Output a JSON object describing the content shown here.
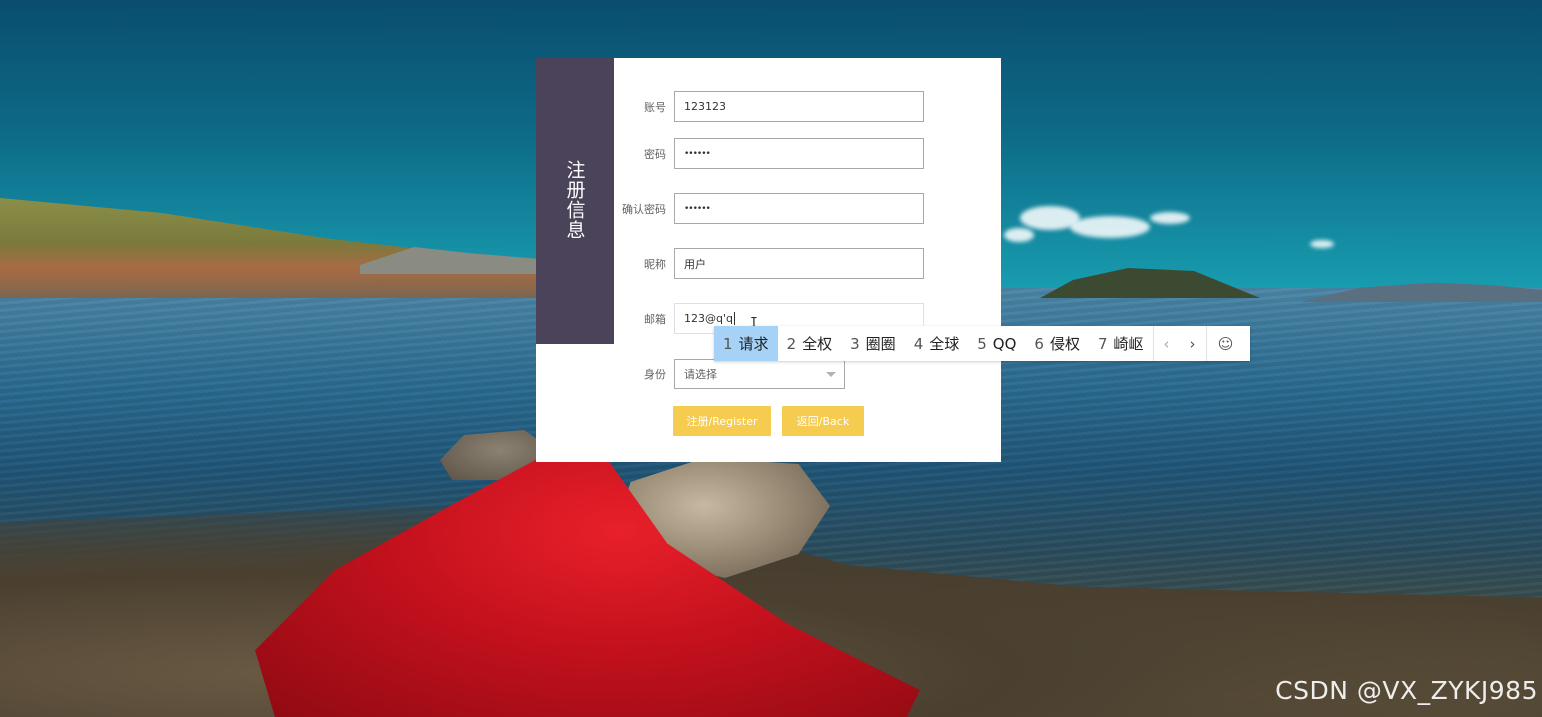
{
  "form": {
    "side_title": "注册信息",
    "fields": {
      "account": {
        "label": "账号",
        "value": "123123"
      },
      "password": {
        "label": "密码",
        "value": "••••••"
      },
      "confirm_password": {
        "label": "确认密码",
        "value": "••••••"
      },
      "nickname": {
        "label": "昵称",
        "value": "用户"
      },
      "email": {
        "label": "邮箱",
        "value": "123@q'q"
      },
      "role": {
        "label": "身份",
        "placeholder": "请选择"
      }
    },
    "buttons": {
      "register": "注册/Register",
      "back": "返回/Back"
    }
  },
  "ime": {
    "candidates": [
      {
        "num": "1",
        "text": "请求"
      },
      {
        "num": "2",
        "text": "全权"
      },
      {
        "num": "3",
        "text": "圈圈"
      },
      {
        "num": "4",
        "text": "全球"
      },
      {
        "num": "5",
        "text": "QQ"
      },
      {
        "num": "6",
        "text": "侵权"
      },
      {
        "num": "7",
        "text": "崎岖"
      }
    ],
    "prev": "‹",
    "next": "›",
    "emoji": "☺"
  },
  "watermark": "CSDN @VX_ZYKJ985",
  "colors": {
    "side_panel": "#4a4359",
    "button": "#f5cb50",
    "ime_highlight": "#a6d2f7"
  }
}
